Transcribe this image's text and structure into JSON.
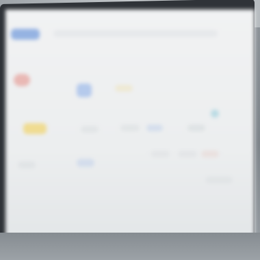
{
  "colors": {
    "screen_bg": "#eef0f1",
    "brand_blue": "#4a7fd6",
    "accent_red": "#e2736b",
    "accent_yellow": "#f1cf52",
    "accent_blue": "#6f9be6",
    "accent_teal": "#8fcadb",
    "muted_gray": "#cfd4d8",
    "bezel": "#2f3338"
  },
  "icons": {
    "logo": "app-logo",
    "status_dot": "status-dot",
    "selection": "selection-marker"
  }
}
